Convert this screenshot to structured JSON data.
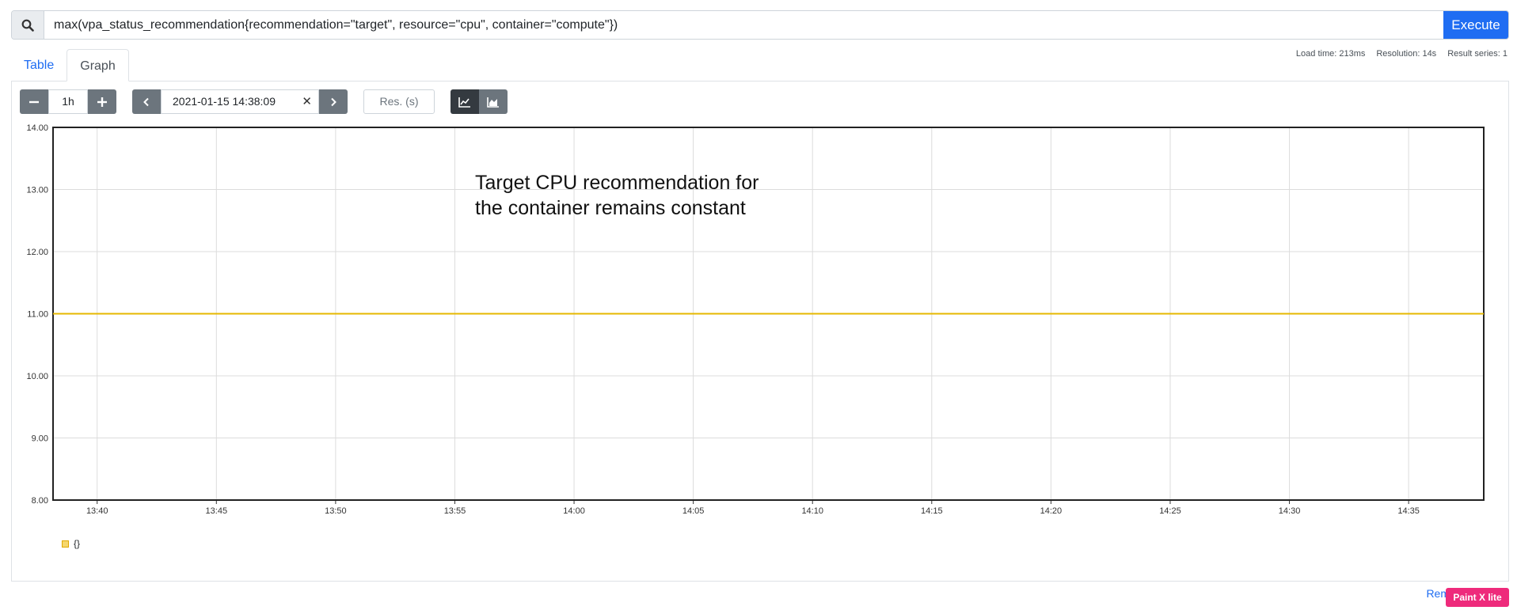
{
  "query": {
    "value": "max(vpa_status_recommendation{recommendation=\"target\", resource=\"cpu\", container=\"compute\"})",
    "execute_label": "Execute"
  },
  "tabs": [
    {
      "label": "Table",
      "active": false
    },
    {
      "label": "Graph",
      "active": true
    }
  ],
  "stats": {
    "load_time": "Load time: 213ms",
    "resolution": "Resolution: 14s",
    "result_series": "Result series: 1"
  },
  "controls": {
    "range": "1h",
    "end_time": "2021-01-15 14:38:09",
    "resolution_placeholder": "Res. (s)"
  },
  "annotation": {
    "line1": "Target CPU recommendation for",
    "line2": "the container remains constant"
  },
  "legend": {
    "label": "{}"
  },
  "footer": {
    "link_text": "Rem",
    "badge": "Paint X lite"
  },
  "colors": {
    "accent": "#1f6df2",
    "series": "#e6b800"
  },
  "chart_data": {
    "type": "line",
    "ylim": [
      8,
      14
    ],
    "yticks": [
      "14.00",
      "13.00",
      "12.00",
      "11.00",
      "10.00",
      "9.00",
      "8.00"
    ],
    "ytick_values": [
      14,
      13,
      12,
      11,
      10,
      9,
      8
    ],
    "xticks": [
      "13:40",
      "13:45",
      "13:50",
      "13:55",
      "14:00",
      "14:05",
      "14:10",
      "14:15",
      "14:20",
      "14:25",
      "14:30",
      "14:35"
    ],
    "xrange": [
      "13:38:09",
      "14:38:09"
    ],
    "series": [
      {
        "x": [
          "13:38:09",
          "14:38:09"
        ],
        "values": [
          11,
          11
        ]
      }
    ],
    "grid": true
  }
}
